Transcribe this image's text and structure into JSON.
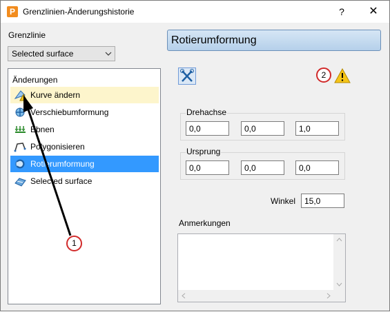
{
  "window": {
    "title": "Grenzlinien-Änderungshistorie",
    "app_icon_letter": "P",
    "help_label": "?",
    "close_label": "✕"
  },
  "left": {
    "grenzlinie_label": "Grenzlinie",
    "combo_value": "Selected surface",
    "tree_header": "Änderungen",
    "items": [
      {
        "label": "Kurve ändern",
        "icon": "curve-edit-warning-icon",
        "state": "highlight"
      },
      {
        "label": "Verschiebumformung",
        "icon": "shift-transform-icon",
        "state": "normal"
      },
      {
        "label": "Ebnen",
        "icon": "flatten-icon",
        "state": "normal"
      },
      {
        "label": "Polygonisieren",
        "icon": "polygonize-icon",
        "state": "normal"
      },
      {
        "label": "Rotierumformung",
        "icon": "rotate-transform-icon",
        "state": "selected"
      },
      {
        "label": "Selected surface",
        "icon": "surface-icon",
        "state": "normal"
      }
    ]
  },
  "right": {
    "section_title": "Rotierumformung",
    "drehachse": {
      "label": "Drehachse",
      "values": [
        "0,0",
        "0,0",
        "1,0"
      ]
    },
    "ursprung": {
      "label": "Ursprung",
      "values": [
        "0,0",
        "0,0",
        "0,0"
      ]
    },
    "winkel": {
      "label": "Winkel",
      "value": "15,0"
    },
    "anmerkungen": {
      "label": "Anmerkungen",
      "value": ""
    }
  },
  "callouts": {
    "one": "1",
    "two": "2"
  },
  "colors": {
    "selection": "#3399ff",
    "highlight": "#fdf5cc",
    "callout": "#d12a2a",
    "warning": "#f5c518"
  }
}
